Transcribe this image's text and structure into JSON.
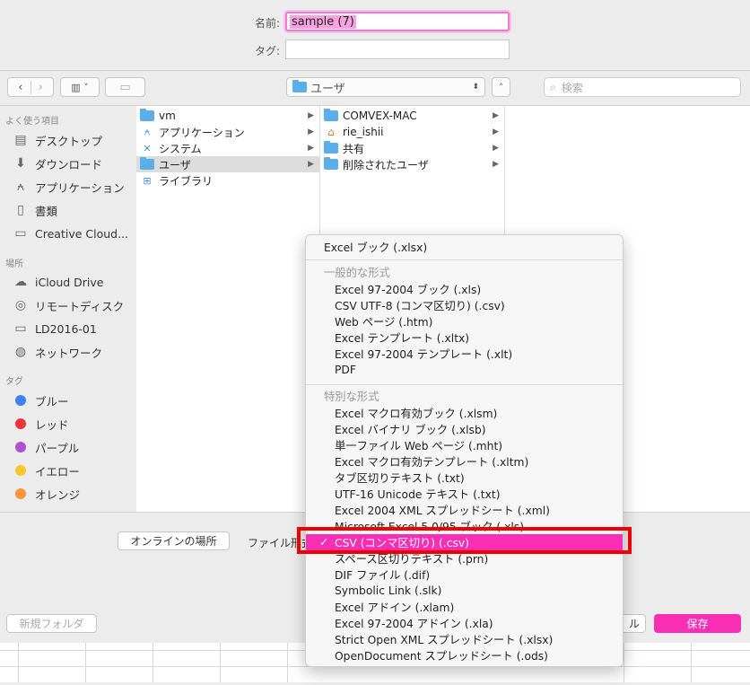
{
  "name_label": "名前:",
  "name_value": "sample (7)",
  "tag_label": "タグ:",
  "location": "ユーザ",
  "search_placeholder": "検索",
  "sidebar": {
    "favorites_title": "よく使う項目",
    "favorites": [
      {
        "label": "デスクトップ",
        "icon": "desktop-icon"
      },
      {
        "label": "ダウンロード",
        "icon": "download-icon"
      },
      {
        "label": "アプリケーション",
        "icon": "applications-icon"
      },
      {
        "label": "書類",
        "icon": "documents-icon"
      },
      {
        "label": "Creative Cloud...",
        "icon": "folder-icon"
      }
    ],
    "places_title": "場所",
    "places": [
      {
        "label": "iCloud Drive",
        "icon": "cloud-icon"
      },
      {
        "label": "リモートディスク",
        "icon": "disc-icon"
      },
      {
        "label": "LD2016-01",
        "icon": "display-icon"
      },
      {
        "label": "ネットワーク",
        "icon": "network-icon"
      }
    ],
    "tags_title": "タグ",
    "tags": [
      {
        "label": "ブルー",
        "color": "#3b82f6"
      },
      {
        "label": "レッド",
        "color": "#f0323a"
      },
      {
        "label": "パープル",
        "color": "#b34fd1"
      },
      {
        "label": "イエロー",
        "color": "#f8c72c"
      },
      {
        "label": "オレンジ",
        "color": "#f7953a"
      }
    ]
  },
  "column1": [
    {
      "label": "vm",
      "icon": "folder-icon",
      "selected": false
    },
    {
      "label": "アプリケーション",
      "icon": "applications-icon",
      "selected": false
    },
    {
      "label": "システム",
      "icon": "system-icon",
      "selected": false
    },
    {
      "label": "ユーザ",
      "icon": "folder-icon",
      "selected": true
    },
    {
      "label": "ライブラリ",
      "icon": "library-icon",
      "selected": false
    }
  ],
  "column2": [
    {
      "label": "COMVEX-MAC",
      "icon": "folder-icon"
    },
    {
      "label": "rie_ishii",
      "icon": "home-icon"
    },
    {
      "label": "共有",
      "icon": "folder-icon"
    },
    {
      "label": "削除されたユーザ",
      "icon": "folder-icon"
    }
  ],
  "bottom": {
    "online_button": "オンラインの場所",
    "file_format_label": "ファイル形式",
    "new_folder_button": "新規フォルダ",
    "cancel_partial": "ル",
    "save_button": "保存"
  },
  "menu": {
    "top_item": "Excel ブック (.xlsx)",
    "section1_title": "一般的な形式",
    "section1": [
      "Excel 97-2004 ブック (.xls)",
      "CSV UTF-8 (コンマ区切り) (.csv)",
      "Web ページ (.htm)",
      "Excel テンプレート (.xltx)",
      "Excel 97-2004 テンプレート (.xlt)",
      "PDF"
    ],
    "section2_title": "特別な形式",
    "section2": [
      "Excel マクロ有効ブック (.xlsm)",
      "Excel バイナリ ブック (.xlsb)",
      "単一ファイル Web ページ (.mht)",
      "Excel マクロ有効テンプレート (.xltm)",
      "タブ区切りテキスト (.txt)",
      "UTF-16 Unicode テキスト (.txt)",
      "Excel 2004 XML スプレッドシート (.xml)",
      "Microsoft Excel 5.0/95 ブック (.xls)",
      "CSV (コンマ区切り) (.csv)",
      "スペース区切りテキスト (.prn)",
      "DIF ファイル (.dif)",
      "Symbolic Link (.slk)",
      "Excel アドイン (.xlam)",
      "Excel 97-2004 アドイン (.xla)",
      "Strict Open XML スプレッドシート (.xlsx)",
      "OpenDocument スプレッドシート (.ods)"
    ],
    "selected_index": 8,
    "checkmark": "✓"
  },
  "colors": {
    "accent": "#f82fb5",
    "highlight_box": "#ee0000",
    "folder": "#5aaee9"
  }
}
